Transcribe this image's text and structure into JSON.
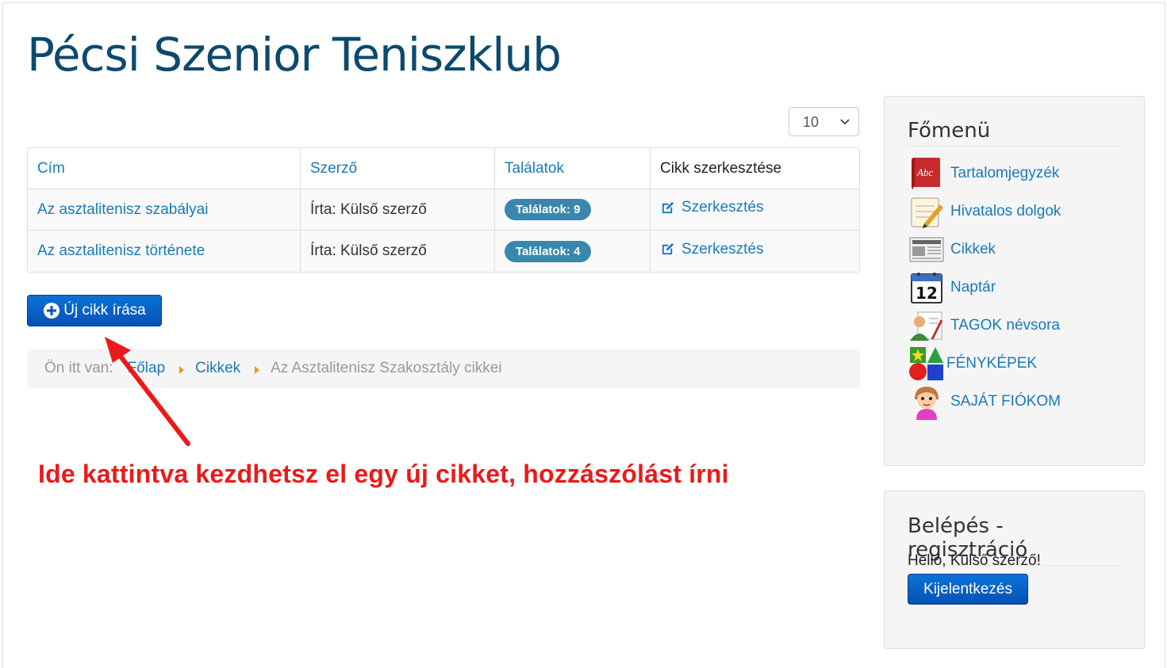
{
  "site": {
    "title": "Pécsi Szenior Teniszklub"
  },
  "list_limit": {
    "value": "10"
  },
  "table": {
    "headers": [
      "Cím",
      "Szerző",
      "Találatok",
      "Cikk szerkesztése"
    ],
    "rows": [
      {
        "title": "Az asztalitenisz szabályai",
        "author": "Írta: Külső szerző",
        "hits": "Találatok: 9",
        "edit": "Szerkesztés"
      },
      {
        "title": "Az asztalitenisz története",
        "author": "Írta: Külső szerző",
        "hits": "Találatok: 4",
        "edit": "Szerkesztés"
      }
    ]
  },
  "new_article_button": "Új cikk írása",
  "breadcrumb": {
    "label": "Ön itt van:",
    "items": [
      "Főlap",
      "Cikkek"
    ],
    "current": "Az Asztalitenisz Szakosztály cikkei"
  },
  "annotation": {
    "text": "Ide kattintva kezdhetsz el egy új cikket, hozzászólást írni",
    "color": "#ea1a1a"
  },
  "main_menu": {
    "title": "Főmenü",
    "items": [
      {
        "label": "Tartalomjegyzék",
        "icon": "book-icon"
      },
      {
        "label": "Hivatalos dolgok",
        "icon": "notepad-icon"
      },
      {
        "label": "Cikkek",
        "icon": "newspaper-icon"
      },
      {
        "label": "Naptár",
        "icon": "calendar-icon"
      },
      {
        "label": "TAGOK névsora",
        "icon": "members-icon"
      },
      {
        "label": "FÉNYKÉPEK",
        "icon": "shapes-icon"
      },
      {
        "label": "SAJÁT FIÓKOM",
        "icon": "avatar-icon"
      }
    ]
  },
  "login": {
    "title": "Belépés - regisztráció",
    "greeting": "Helló, Külső szerző!",
    "logout_button": "Kijelentkezés"
  },
  "colors": {
    "link": "#1a7ab8",
    "title": "#0b4a6e",
    "badge": "#3a87ad",
    "button": "#0552b5"
  }
}
